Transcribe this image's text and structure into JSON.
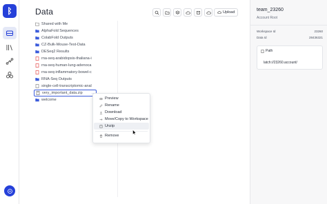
{
  "app": {
    "logo_glyph": "ᛒ",
    "help_icon": "help-icon"
  },
  "rail": {
    "items": [
      {
        "name": "data-icon",
        "active": true
      },
      {
        "name": "library-icon",
        "active": false
      },
      {
        "name": "workflow-icon",
        "active": false
      },
      {
        "name": "apps-icon",
        "active": false
      }
    ]
  },
  "main": {
    "title": "Data",
    "toolbar": [
      "search-icon",
      "folder-add-icon",
      "stack-icon",
      "cloud-icon",
      "bucket-icon",
      "cloud-outline-icon"
    ],
    "upload_label": "Upload"
  },
  "tree": {
    "items": [
      {
        "label": "Shared with Me",
        "type": "folder-outline"
      },
      {
        "label": "AlphaFold Sequences",
        "type": "folder"
      },
      {
        "label": "ColabFold Outputs",
        "type": "folder"
      },
      {
        "label": "CZ-Bulk-Mouse-Test-Data",
        "type": "folder"
      },
      {
        "label": "DESeq2 Results",
        "type": "folder"
      },
      {
        "label": "rna-seq-arabidopsis-thaliana-i",
        "type": "file"
      },
      {
        "label": "rna-seq-human-lung-adenoca",
        "type": "file"
      },
      {
        "label": "rna-seq-inflammatory-bowel-c",
        "type": "file"
      },
      {
        "label": "RNA-Seq Outputs",
        "type": "folder"
      },
      {
        "label": "single-cell-transcriptomic-anal",
        "type": "file-gray"
      },
      {
        "label": "very_important_data.zip",
        "type": "zip",
        "selected": true,
        "more": "···"
      },
      {
        "label": "welcome",
        "type": "folder"
      }
    ]
  },
  "context_menu": {
    "items": [
      {
        "label": "Preview",
        "icon": "eye-icon"
      },
      {
        "label": "Rename",
        "icon": "pencil-icon"
      },
      {
        "label": "Download",
        "icon": "download-icon"
      },
      {
        "label": "Move/Copy to Workspace",
        "icon": "arrow-right-icon"
      },
      {
        "label": "Unzip",
        "icon": "unzip-icon",
        "hover": true
      },
      {
        "label": "Remove",
        "icon": "trash-icon",
        "sep_before": true
      }
    ]
  },
  "account": {
    "name": "team_23260",
    "subtitle": "Account Root",
    "workspace_id_label": "Workspace Id",
    "workspace_id": "23260",
    "data_id_label": "Data Id",
    "data_id": "28436321",
    "path_label": "Path",
    "path_value": "latch://23260.account/"
  },
  "colors": {
    "accent": "#2540d9",
    "selection": "#3b5bdb"
  }
}
